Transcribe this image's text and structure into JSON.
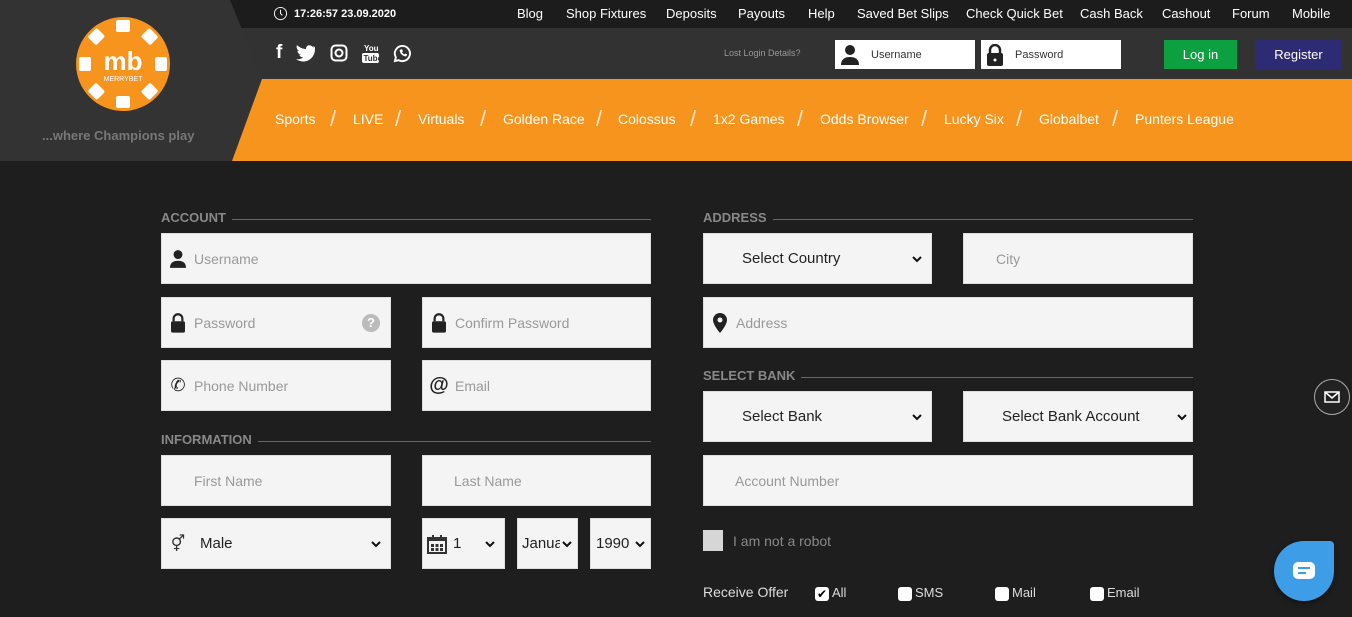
{
  "header": {
    "clock": "17:26:57 23.09.2020",
    "tagline": "...where Champions play",
    "logo_text": "mb MERRYBET",
    "top_links": [
      "Blog",
      "Shop Fixtures",
      "Deposits",
      "Payouts",
      "Help",
      "Saved Bet Slips",
      "Check Quick Bet",
      "Cash Back",
      "Cashout",
      "Forum",
      "Mobile"
    ],
    "social_icons": [
      "facebook-icon",
      "twitter-icon",
      "instagram-icon",
      "youtube-icon",
      "whatsapp-icon"
    ],
    "lost_login": "Lost Login Details?",
    "username_placeholder": "Username",
    "password_placeholder": "Password",
    "login_label": "Log in",
    "register_label": "Register",
    "nav": [
      "Sports",
      "LIVE",
      "Virtuals",
      "Golden Race",
      "Colossus",
      "1x2 Games",
      "Odds Browser",
      "Lucky Six",
      "Globalbet",
      "Punters League"
    ]
  },
  "colors": {
    "orange": "#f7941d",
    "login": "#0ca040",
    "register": "#2d2b73",
    "chat": "#3d9de6"
  },
  "form": {
    "account_title": "ACCOUNT",
    "username": "Username",
    "password": "Password",
    "confirm_password": "Confirm Password",
    "phone": "Phone Number",
    "email": "Email",
    "information_title": "INFORMATION",
    "first_name": "First Name",
    "last_name": "Last Name",
    "gender": "Male",
    "day": "1",
    "month": "Janua",
    "year": "1990",
    "address_title": "ADDRESS",
    "country": "Select Country",
    "city": "City",
    "address": "Address",
    "bank_title": "SELECT BANK",
    "bank": "Select Bank",
    "bank_account": "Select Bank Account",
    "account_number": "Account Number",
    "robot": "I am not a robot",
    "receive_offer": "Receive Offer",
    "offers": [
      {
        "label": "All",
        "checked": true
      },
      {
        "label": "SMS",
        "checked": false
      },
      {
        "label": "Mail",
        "checked": false
      },
      {
        "label": "Email",
        "checked": false
      }
    ]
  }
}
